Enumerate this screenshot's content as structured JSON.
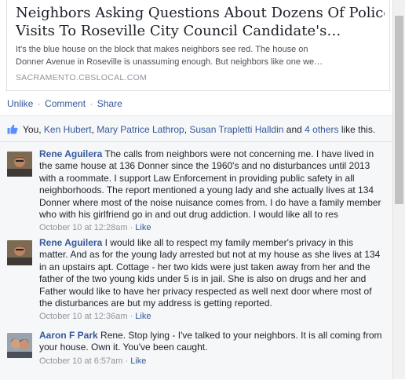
{
  "link": {
    "title_line1": "Neighbors Asking Questions About Dozens Of Police",
    "title_line2": "Visits To Roseville City Council Candidate's…",
    "desc_line1": "It's the blue house on the block that makes neighbors see red. The house on",
    "desc_line2": "Donner Avenue in Roseville is unassuming enough. But neighbors like one we…",
    "domain": "SACRAMENTO.CBSLOCAL.COM"
  },
  "actions": {
    "unlike": "Unlike",
    "comment": "Comment",
    "share": "Share",
    "separator": "·"
  },
  "likes": {
    "prefix": "You, ",
    "person1": "Ken Hubert",
    "comma": ", ",
    "person2": "Mary Patrice Lathrop",
    "person3": "Susan Trapletti Halldin",
    "and": " and ",
    "others": "4 others",
    "suffix": " like this.",
    "accent": "#365899"
  },
  "comments": [
    {
      "author": "Rene Aguilera",
      "text": "The calls from neighbors were not concerning me. I have lived in the same house at 136 Donner since the 1960's and no disturbances until 2013 with a roommate. I support Law Enforcement in providing public safety in all neighborhoods. The report mentioned a young lady and she actually lives at 134 Donner where most of the noise nuisance comes from. I do have a family member who with his girlfriend go in and out drug addiction. I would like all to res",
      "time": "October 10 at 12:28am",
      "like": "Like"
    },
    {
      "author": "Rene Aguilera",
      "text": "I would like all to respect my family member's privacy in this matter. And as for the young lady arrested but not at my house as she lives at 134 in an upstairs apt. Cottage - her two kids were just taken away from her and the father of the two young kids under 5 is in jail. She is also on drugs and her and Father would like to have her privacy respected as well next door where most of the disturbances are but my address is getting reported.",
      "time": "October 10 at 12:36am",
      "like": "Like"
    },
    {
      "author": "Aaron F Park",
      "text": "Rene. Stop lying - I've talked to your neighbors. It is all coming from your house. Own it. You've been caught.",
      "time": "October 10 at 6:57am",
      "like": "Like"
    }
  ],
  "meta_separator": " · "
}
